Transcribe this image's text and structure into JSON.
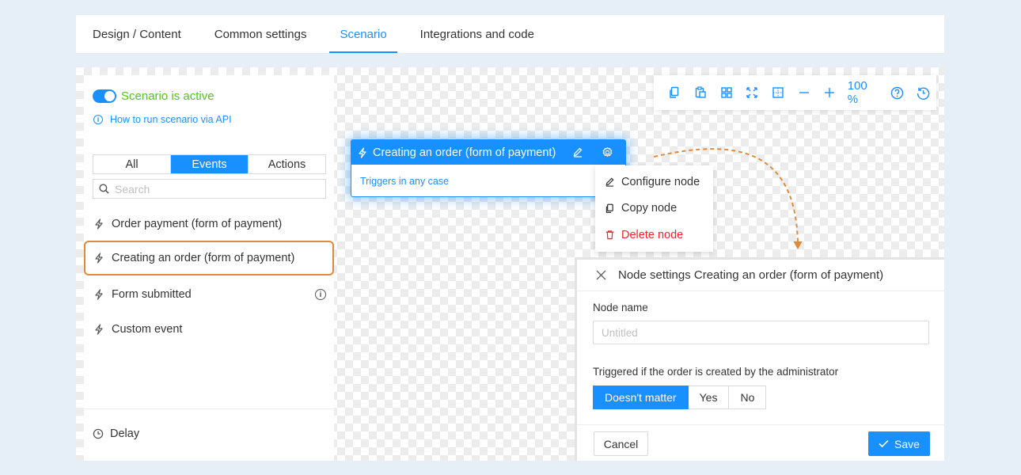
{
  "tabs": [
    {
      "label": "Design / Content",
      "active": false
    },
    {
      "label": "Common settings",
      "active": false
    },
    {
      "label": "Scenario",
      "active": true
    },
    {
      "label": "Integrations and code",
      "active": false
    }
  ],
  "sidebar": {
    "toggle_label": "Scenario is active",
    "api_link": "How to run scenario via API",
    "filters": [
      "All",
      "Events",
      "Actions"
    ],
    "active_filter": "Events",
    "search_placeholder": "Search",
    "events": [
      {
        "label": "Order payment (form of payment)",
        "icon": "bolt-icon"
      },
      {
        "label": "Creating an order (form of payment)",
        "icon": "bolt-icon",
        "highlighted": true
      },
      {
        "label": "Form submitted",
        "icon": "bolt-icon",
        "info": true
      },
      {
        "label": "Custom event",
        "icon": "bolt-icon"
      }
    ],
    "delay_label": "Delay"
  },
  "toolbar": {
    "icons": [
      "copy-icon",
      "paste-icon",
      "grid-icon",
      "fit-screen-icon",
      "align-grid-icon",
      "zoom-out-icon",
      "zoom-in-icon"
    ],
    "zoom": "100 %",
    "end_icons": [
      "help-icon",
      "history-icon"
    ]
  },
  "node": {
    "title": "Creating an order (form of payment)",
    "body": "Triggers in any case"
  },
  "context_menu": {
    "items": [
      {
        "label": "Configure node",
        "icon": "pencil-icon"
      },
      {
        "label": "Copy node",
        "icon": "copy-icon"
      },
      {
        "label": "Delete node",
        "icon": "trash-icon",
        "danger": true
      }
    ]
  },
  "panel": {
    "title": "Node settings Creating an order (form of payment)",
    "node_name_label": "Node name",
    "node_name_placeholder": "Untitled",
    "node_name_value": "",
    "admin_label": "Triggered if the order is created by the administrator",
    "admin_options": [
      "Doesn't matter",
      "Yes",
      "No"
    ],
    "admin_selected": "Doesn't matter",
    "cancel_label": "Cancel",
    "save_label": "Save"
  },
  "colors": {
    "accent": "#1890ff",
    "active_green": "#52c41a",
    "highlight_orange": "#e08a3c",
    "danger": "#f5222d"
  }
}
